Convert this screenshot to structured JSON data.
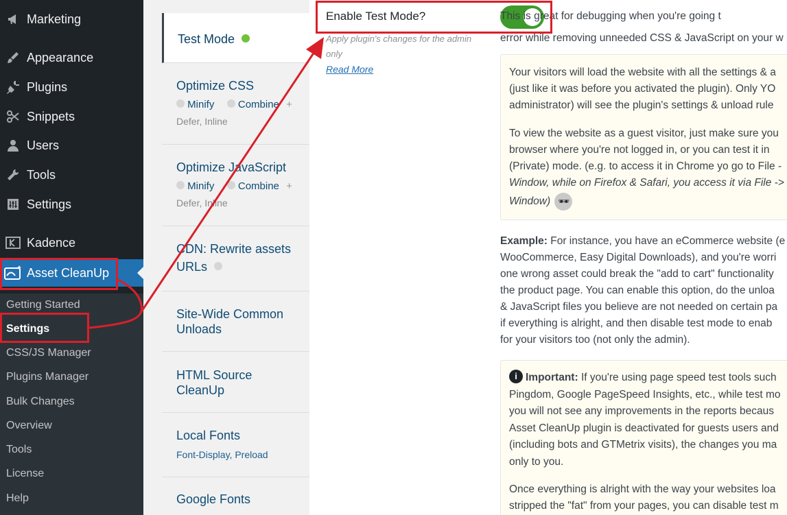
{
  "sidebar": {
    "menu": [
      {
        "label": "Marketing",
        "icon": "megaphone-icon"
      },
      {
        "label": "Appearance",
        "icon": "paintbrush-icon"
      },
      {
        "label": "Plugins",
        "icon": "plugin-icon"
      },
      {
        "label": "Snippets",
        "icon": "scissors-icon"
      },
      {
        "label": "Users",
        "icon": "user-icon"
      },
      {
        "label": "Tools",
        "icon": "wrench-icon"
      },
      {
        "label": "Settings",
        "icon": "sliders-icon"
      },
      {
        "label": "Kadence",
        "icon": "kadence-icon"
      },
      {
        "label": "Asset CleanUp",
        "icon": "asset-cleanup-icon"
      }
    ],
    "submenu": [
      "Getting Started",
      "Settings",
      "CSS/JS Manager",
      "Plugins Manager",
      "Bulk Changes",
      "Overview",
      "Tools",
      "License",
      "Help"
    ]
  },
  "tabs": {
    "test_mode": "Test Mode",
    "optimize_css": "Optimize CSS",
    "optimize_js": "Optimize JavaScript",
    "minify": "Minify",
    "combine": "Combine",
    "plus": "+",
    "defer_inline": "Defer, Inline",
    "cdn_line1": "CDN: Rewrite assets",
    "cdn_line2": "URLs",
    "sitewide_line1": "Site-Wide Common",
    "sitewide_line2": "Unloads",
    "html_line1": "HTML Source",
    "html_line2": "CleanUp",
    "local_fonts": "Local Fonts",
    "local_fonts_sub": "Font-Display, Preload",
    "google_fonts": "Google Fonts"
  },
  "main": {
    "toggle_label": "Enable Test Mode?",
    "hint": "Apply plugin's changes for the admin only",
    "read_more": "Read More",
    "desc_line1": "This is great for debugging when you're going t",
    "desc_line2": "error while removing unneeded CSS & JavaScript on your w",
    "box1": [
      "Your visitors will load the website with all the settings & a",
      "(just like it was before you activated the plugin). Only YO",
      "administrator) will see the plugin's settings & unload rule"
    ],
    "box1b": [
      "To view the website as a guest visitor, just make sure you",
      "browser where you're not logged in, or you can test it in",
      "(Private) mode. (e.g. to access it in Chrome yo go to File -",
      "Window, while on Firefox & Safari, you access it via File ->",
      "Window)"
    ],
    "example_label": "Example:",
    "example": [
      " For instance, you have an eCommerce website (e",
      "WooCommerce, Easy Digital Downloads), and you're worri",
      "one wrong asset could break the \"add to cart\" functionality",
      "the product page. You can enable this option, do the unloa",
      "& JavaScript files you believe are not needed on certain pa",
      "if everything is alright, and then disable test mode to enab",
      "for your visitors too (not only the admin)."
    ],
    "important_label": "Important:",
    "important": [
      " If you're using page speed test tools such",
      "Pingdom, Google PageSpeed Insights, etc., while test mo",
      "you will not see any improvements in the reports becaus",
      "Asset CleanUp plugin is deactivated for guests users and",
      "(including bots and GTMetrix visits), the changes you ma",
      "only to you."
    ],
    "final": [
      "Once everything is alright with the way your websites loa",
      "stripped the \"fat\" from your pages, you can disable test m"
    ]
  },
  "colors": {
    "accent": "#2271b1",
    "annotation": "#d9202a",
    "toggle_on": "#3e9b2b",
    "status_dot": "#72c13c"
  }
}
